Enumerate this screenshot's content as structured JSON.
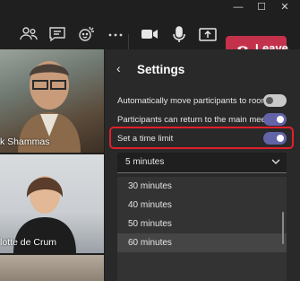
{
  "window_controls": {
    "minimize": "—",
    "maximize": "☐",
    "close": "✕"
  },
  "toolbar": {
    "icons": [
      "people-icon",
      "chat-icon",
      "reactions-icon",
      "more-icon",
      "camera-icon",
      "mic-icon",
      "share-icon"
    ],
    "leave_label": "Leave"
  },
  "participants": [
    {
      "name": "k Shammas"
    },
    {
      "name": "lotte de Crum"
    },
    {
      "name": ""
    }
  ],
  "settings": {
    "title": "Settings",
    "rows": [
      {
        "label": "Automatically move participants to rooms",
        "on": false
      },
      {
        "label": "Participants can return to the main meeting",
        "on": true
      },
      {
        "label": "Set a time limit",
        "on": true
      }
    ],
    "select_value": "5 minutes",
    "options": [
      "30 minutes",
      "40 minutes",
      "50 minutes",
      "60 minutes"
    ],
    "selected_option": "60 minutes"
  },
  "colors": {
    "accent": "#6264a7",
    "leave": "#c4314b",
    "highlight": "#e0202c"
  }
}
